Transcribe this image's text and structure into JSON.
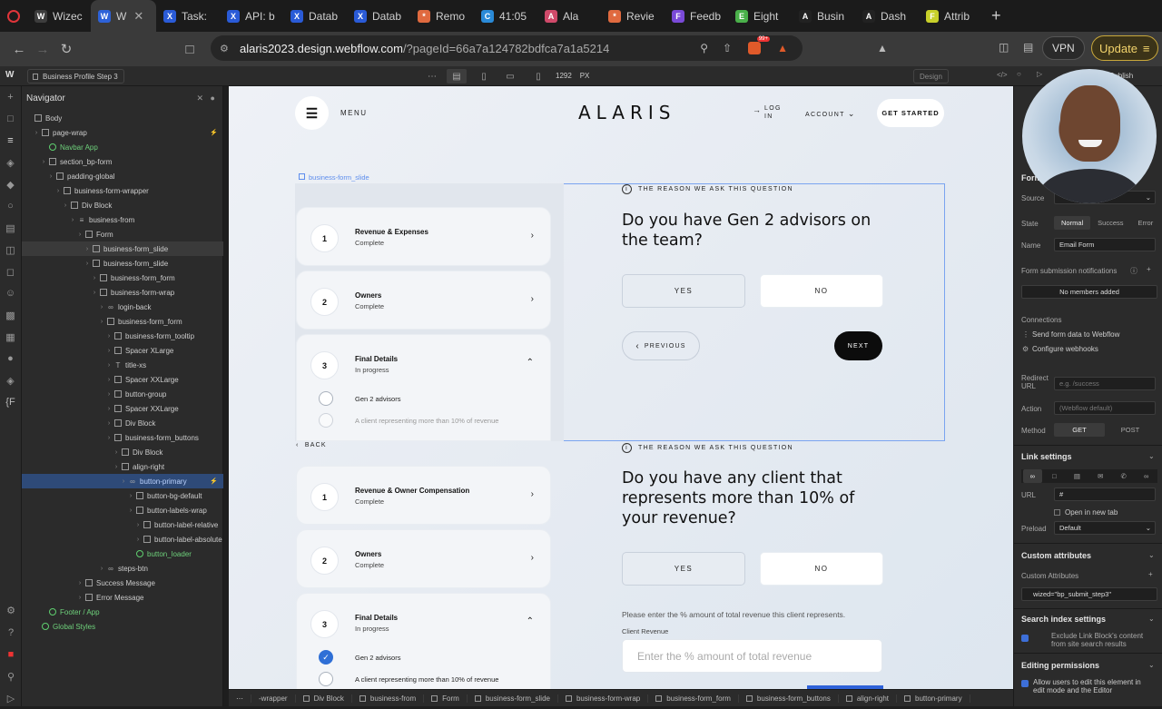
{
  "browser": {
    "tabs": [
      {
        "label": "",
        "icon": "record-icon",
        "color": "#e0353a"
      },
      {
        "label": "Wizec",
        "icon": "W",
        "color": "#3d3d3d"
      },
      {
        "label": "W",
        "icon": "W",
        "color": "#2d62d8",
        "active": true
      },
      {
        "label": "Task:",
        "icon": "X",
        "color": "#2a5bd7"
      },
      {
        "label": "API: b",
        "icon": "X",
        "color": "#2a5bd7"
      },
      {
        "label": "Datab",
        "icon": "X",
        "color": "#2a5bd7"
      },
      {
        "label": "Datab",
        "icon": "X",
        "color": "#2a5bd7"
      },
      {
        "label": "Remo",
        "icon": "*",
        "color": "#e06a3f"
      },
      {
        "label": "41:05",
        "icon": "C",
        "color": "#2a8ad7"
      },
      {
        "label": "Ala",
        "icon": "A",
        "color": "#d04a6a"
      },
      {
        "label": "Revie",
        "icon": "*",
        "color": "#e06a3f"
      },
      {
        "label": "Feedb",
        "icon": "F",
        "color": "#7a4ad8"
      },
      {
        "label": "Eight",
        "icon": "E",
        "color": "#4ab04a"
      },
      {
        "label": "Busin",
        "icon": "A",
        "color": "#222222"
      },
      {
        "label": "Dash",
        "icon": "A",
        "color": "#222222"
      },
      {
        "label": "Attrib",
        "icon": "F",
        "color": "#c8d02a"
      }
    ],
    "url_host": "alaris2023.design.webflow.com",
    "url_path": "/?pageId=66a7a124782bdfca7a1a5214",
    "vpn_label": "VPN",
    "update_label": "Update",
    "badge": "99+"
  },
  "designer": {
    "page_name": "Business Profile Step 3",
    "width_value": "1292",
    "width_unit": "PX",
    "mode_label": "Design",
    "publish_label": "Publish"
  },
  "navigator": {
    "title": "Navigator",
    "items": [
      {
        "label": "Body",
        "indent": 0,
        "kind": "box"
      },
      {
        "label": "page-wrap",
        "indent": 1,
        "kind": "box"
      },
      {
        "label": "Navbar App",
        "indent": 2,
        "kind": "comp",
        "green": true
      },
      {
        "label": "section_bp-form",
        "indent": 2,
        "kind": "box"
      },
      {
        "label": "padding-global",
        "indent": 3,
        "kind": "box"
      },
      {
        "label": "business-form-wrapper",
        "indent": 4,
        "kind": "box"
      },
      {
        "label": "Div Block",
        "indent": 5,
        "kind": "box"
      },
      {
        "label": "business-from",
        "indent": 6,
        "kind": "form"
      },
      {
        "label": "Form",
        "indent": 7,
        "kind": "box"
      },
      {
        "label": "business-form_slide",
        "indent": 8,
        "kind": "box",
        "hover": true
      },
      {
        "label": "business-form_slide",
        "indent": 8,
        "kind": "box"
      },
      {
        "label": "business-form_form",
        "indent": 9,
        "kind": "box"
      },
      {
        "label": "business-form-wrap",
        "indent": 9,
        "kind": "box"
      },
      {
        "label": "login-back",
        "indent": 10,
        "kind": "link"
      },
      {
        "label": "business-form_form",
        "indent": 10,
        "kind": "box"
      },
      {
        "label": "business-form_tooltip",
        "indent": 11,
        "kind": "box"
      },
      {
        "label": "Spacer XLarge",
        "indent": 11,
        "kind": "box"
      },
      {
        "label": "title-xs",
        "indent": 11,
        "kind": "text"
      },
      {
        "label": "Spacer XXLarge",
        "indent": 11,
        "kind": "box"
      },
      {
        "label": "button-group",
        "indent": 11,
        "kind": "box"
      },
      {
        "label": "Spacer XXLarge",
        "indent": 11,
        "kind": "box"
      },
      {
        "label": "Div Block",
        "indent": 11,
        "kind": "box"
      },
      {
        "label": "business-form_buttons",
        "indent": 11,
        "kind": "box"
      },
      {
        "label": "Div Block",
        "indent": 12,
        "kind": "box"
      },
      {
        "label": "align-right",
        "indent": 12,
        "kind": "box"
      },
      {
        "label": "button-primary",
        "indent": 13,
        "kind": "link",
        "selected": true
      },
      {
        "label": "button-bg-default",
        "indent": 14,
        "kind": "box"
      },
      {
        "label": "button-labels-wrap",
        "indent": 14,
        "kind": "box"
      },
      {
        "label": "button-label-relative",
        "indent": 15,
        "kind": "box"
      },
      {
        "label": "button-label-absolute",
        "indent": 15,
        "kind": "box"
      },
      {
        "label": "button_loader",
        "indent": 14,
        "kind": "comp",
        "green": true
      },
      {
        "label": "steps-btn",
        "indent": 10,
        "kind": "link"
      },
      {
        "label": "Success Message",
        "indent": 7,
        "kind": "box"
      },
      {
        "label": "Error Message",
        "indent": 7,
        "kind": "box"
      },
      {
        "label": "Footer / App",
        "indent": 2,
        "kind": "comp",
        "green": true
      },
      {
        "label": "Global Styles",
        "indent": 1,
        "kind": "comp",
        "green": true
      }
    ]
  },
  "site": {
    "logo": "ALARIS",
    "menu_label": "MENU",
    "login_label_1": "LOG",
    "login_label_2": "IN",
    "account_label": "ACCOUNT",
    "get_started": "GET STARTED",
    "selected_label": "business-form_slide",
    "back_label": "BACK",
    "reason_label": "THE REASON WE ASK THIS QUESTION",
    "slide1": {
      "steps": [
        {
          "num": "1",
          "title": "Revenue & Expenses",
          "status": "Complete"
        },
        {
          "num": "2",
          "title": "Owners",
          "status": "Complete"
        },
        {
          "num": "3",
          "title": "Final Details",
          "status": "In progress"
        }
      ],
      "options": [
        "Gen 2 advisors",
        "A client representing more than 10% of revenue"
      ],
      "question": "Do you have Gen 2 advisors on the team?",
      "yes": "YES",
      "no": "NO",
      "previous": "PREVIOUS",
      "next": "NEXT"
    },
    "slide2": {
      "steps": [
        {
          "num": "1",
          "title": "Revenue & Owner Compensation",
          "status": "Complete"
        },
        {
          "num": "2",
          "title": "Owners",
          "status": "Complete"
        },
        {
          "num": "3",
          "title": "Final Details",
          "status": "In progress"
        }
      ],
      "options": [
        "Gen 2 advisors",
        "A client representing more than 10% of revenue"
      ],
      "question": "Do you have any client that represents more than 10% of your revenue?",
      "yes": "YES",
      "no": "NO",
      "hint": "Please enter the % amount of total revenue this client represents.",
      "client_label": "Client Revenue",
      "client_placeholder": "Enter the % amount of total revenue"
    }
  },
  "breadcrumb": [
    "-wrapper",
    "Div Block",
    "business-from",
    "Form",
    "business-form_slide",
    "business-form-wrap",
    "business-form_form",
    "business-form_buttons",
    "align-right",
    "button-primary"
  ],
  "settings": {
    "form_head": "Form",
    "source_label": "Source",
    "state_label": "State",
    "states": [
      "Normal",
      "Success",
      "Error"
    ],
    "name_label": "Name",
    "name_value": "Email Form",
    "notif_label": "Form submission notifications",
    "no_members": "No members added",
    "connections_label": "Connections",
    "conn_send": "Send form data to Webflow",
    "conn_hooks": "Configure webhooks",
    "redirect_label": "Redirect URL",
    "redirect_placeholder": "e.g. /success",
    "action_label": "Action",
    "action_placeholder": "(Webflow default)",
    "method_label": "Method",
    "methods": [
      "GET",
      "POST"
    ],
    "link_settings": "Link settings",
    "url_label": "URL",
    "url_value": "#",
    "new_tab": "Open in new tab",
    "preload_label": "Preload",
    "preload_value": "Default",
    "custom_attr_head": "Custom attributes",
    "custom_attr_label": "Custom Attributes",
    "custom_attr_value": "wized=\"bp_submit_step3\"",
    "search_index_head": "Search index settings",
    "search_index_text_1": "Exclude Link Block's content",
    "search_index_text_2": "from site search results",
    "editing_head": "Editing permissions",
    "editing_text_1": "Allow users to edit this element in",
    "editing_text_2": "edit mode and the Editor"
  }
}
